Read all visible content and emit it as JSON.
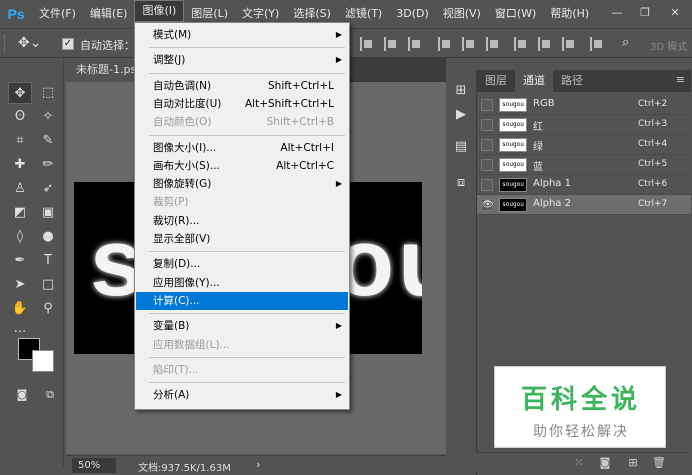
{
  "app": {
    "logo": "Ps"
  },
  "menubar": {
    "items": [
      "文件(F)",
      "编辑(E)",
      "图像(I)",
      "图层(L)",
      "文字(Y)",
      "选择(S)",
      "滤镜(T)",
      "3D(D)",
      "视图(V)",
      "窗口(W)",
      "帮助(H)"
    ],
    "active_index": 2
  },
  "window_controls": {
    "minimize": "—",
    "restore": "❐",
    "close": "✕"
  },
  "options_bar": {
    "auto_select_label": "自动选择：",
    "auto_select_checked": true,
    "mode_3d": "3D 模式"
  },
  "document": {
    "tab_title": "未标题-1.psd",
    "canvas_text": "sougou",
    "zoom": "50%",
    "doc_info": "文档:937.5K/1.63M"
  },
  "image_menu": {
    "items": [
      {
        "label": "模式(M)",
        "shortcut": "",
        "submenu": true,
        "disabled": false
      },
      {
        "sep": true
      },
      {
        "label": "调整(J)",
        "shortcut": "",
        "submenu": true,
        "disabled": false
      },
      {
        "sep": true
      },
      {
        "label": "自动色调(N)",
        "shortcut": "Shift+Ctrl+L",
        "submenu": false,
        "disabled": false
      },
      {
        "label": "自动对比度(U)",
        "shortcut": "Alt+Shift+Ctrl+L",
        "submenu": false,
        "disabled": false
      },
      {
        "label": "自动颜色(O)",
        "shortcut": "Shift+Ctrl+B",
        "submenu": false,
        "disabled": true
      },
      {
        "sep": true
      },
      {
        "label": "图像大小(I)...",
        "shortcut": "Alt+Ctrl+I",
        "submenu": false,
        "disabled": false
      },
      {
        "label": "画布大小(S)...",
        "shortcut": "Alt+Ctrl+C",
        "submenu": false,
        "disabled": false
      },
      {
        "label": "图像旋转(G)",
        "shortcut": "",
        "submenu": true,
        "disabled": false
      },
      {
        "label": "裁剪(P)",
        "shortcut": "",
        "submenu": false,
        "disabled": true
      },
      {
        "label": "裁切(R)...",
        "shortcut": "",
        "submenu": false,
        "disabled": false
      },
      {
        "label": "显示全部(V)",
        "shortcut": "",
        "submenu": false,
        "disabled": false
      },
      {
        "sep": true
      },
      {
        "label": "复制(D)...",
        "shortcut": "",
        "submenu": false,
        "disabled": false
      },
      {
        "label": "应用图像(Y)...",
        "shortcut": "",
        "submenu": false,
        "disabled": false
      },
      {
        "label": "计算(C)...",
        "shortcut": "",
        "submenu": false,
        "disabled": false,
        "highlight": true
      },
      {
        "sep": true
      },
      {
        "label": "变量(B)",
        "shortcut": "",
        "submenu": true,
        "disabled": false
      },
      {
        "label": "应用数据组(L)...",
        "shortcut": "",
        "submenu": false,
        "disabled": true
      },
      {
        "sep": true
      },
      {
        "label": "陷印(T)...",
        "shortcut": "",
        "submenu": false,
        "disabled": true
      },
      {
        "sep": true
      },
      {
        "label": "分析(A)",
        "shortcut": "",
        "submenu": true,
        "disabled": false
      }
    ]
  },
  "channels_panel": {
    "tabs": [
      "图层",
      "通道",
      "路径"
    ],
    "active_tab": 1,
    "menu_icon": "≡",
    "channels": [
      {
        "name": "RGB",
        "shortcut": "Ctrl+2",
        "thumb": "sougou",
        "dark": false,
        "visible": false,
        "selected": false
      },
      {
        "name": "红",
        "shortcut": "Ctrl+3",
        "thumb": "sougou",
        "dark": false,
        "visible": false,
        "selected": false
      },
      {
        "name": "绿",
        "shortcut": "Ctrl+4",
        "thumb": "sougou",
        "dark": false,
        "visible": false,
        "selected": false
      },
      {
        "name": "蓝",
        "shortcut": "Ctrl+5",
        "thumb": "sougou",
        "dark": false,
        "visible": false,
        "selected": false
      },
      {
        "name": "Alpha 1",
        "shortcut": "Ctrl+6",
        "thumb": "sougou",
        "dark": true,
        "visible": false,
        "selected": false
      },
      {
        "name": "Alpha 2",
        "shortcut": "Ctrl+7",
        "thumb": "sougou",
        "dark": true,
        "visible": true,
        "selected": true
      }
    ]
  },
  "watermark": {
    "title": "百科全说",
    "subtitle": "助你轻松解决"
  },
  "colors": {
    "ui_bg": "#535353",
    "highlight": "#0078d7",
    "watermark_green": "#3cb55b",
    "logo_blue": "#31a8ff"
  }
}
